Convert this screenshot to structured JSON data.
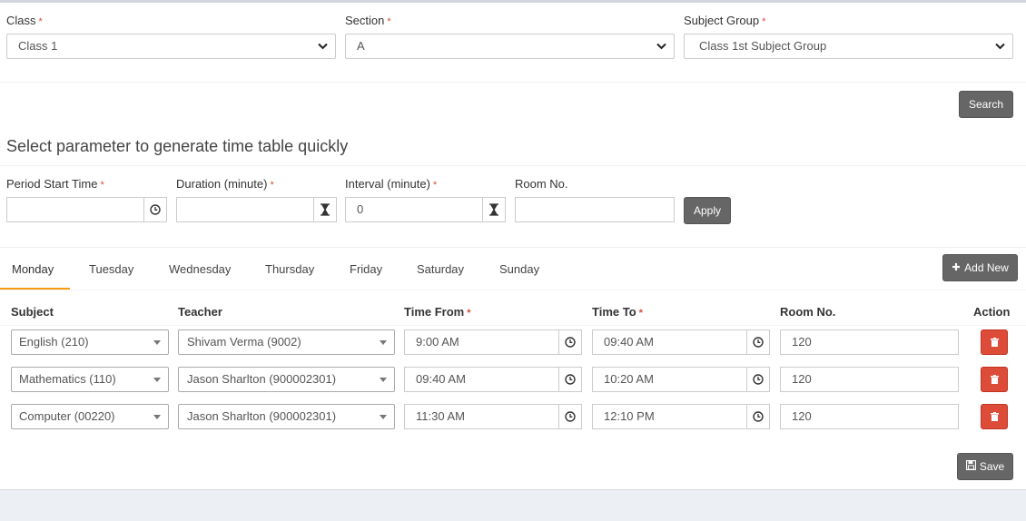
{
  "filters": {
    "class_label": "Class",
    "class_value": "Class 1",
    "section_label": "Section",
    "section_value": "A",
    "subject_group_label": "Subject Group",
    "subject_group_value": "Class 1st Subject Group",
    "required_mark": "*",
    "search_label": "Search"
  },
  "generator": {
    "title": "Select parameter to generate time table quickly",
    "period_start_label": "Period Start Time",
    "period_start_value": "",
    "duration_label": "Duration (minute)",
    "duration_value": "",
    "interval_label": "Interval (minute)",
    "interval_value": "0",
    "room_label": "Room No.",
    "room_value": "",
    "apply_label": "Apply"
  },
  "tabs": [
    "Monday",
    "Tuesday",
    "Wednesday",
    "Thursday",
    "Friday",
    "Saturday",
    "Sunday"
  ],
  "add_new_label": "Add New",
  "table": {
    "headers": {
      "subject": "Subject",
      "teacher": "Teacher",
      "time_from": "Time From",
      "time_to": "Time To",
      "room": "Room No.",
      "action": "Action"
    },
    "rows": [
      {
        "subject": "English (210)",
        "teacher": "Shivam Verma (9002)",
        "time_from": "9:00 AM",
        "time_to": "09:40 AM",
        "room": "120"
      },
      {
        "subject": "Mathematics (110)",
        "teacher": "Jason Sharlton (900002301)",
        "time_from": "09:40 AM",
        "time_to": "10:20 AM",
        "room": "120"
      },
      {
        "subject": "Computer (00220)",
        "teacher": "Jason Sharlton (900002301)",
        "time_from": "11:30 AM",
        "time_to": "12:10 PM",
        "room": "120"
      }
    ]
  },
  "save_label": "Save",
  "colors": {
    "accent_tab": "#f39c12",
    "danger": "#dd4b39",
    "button_dark": "#666666"
  }
}
